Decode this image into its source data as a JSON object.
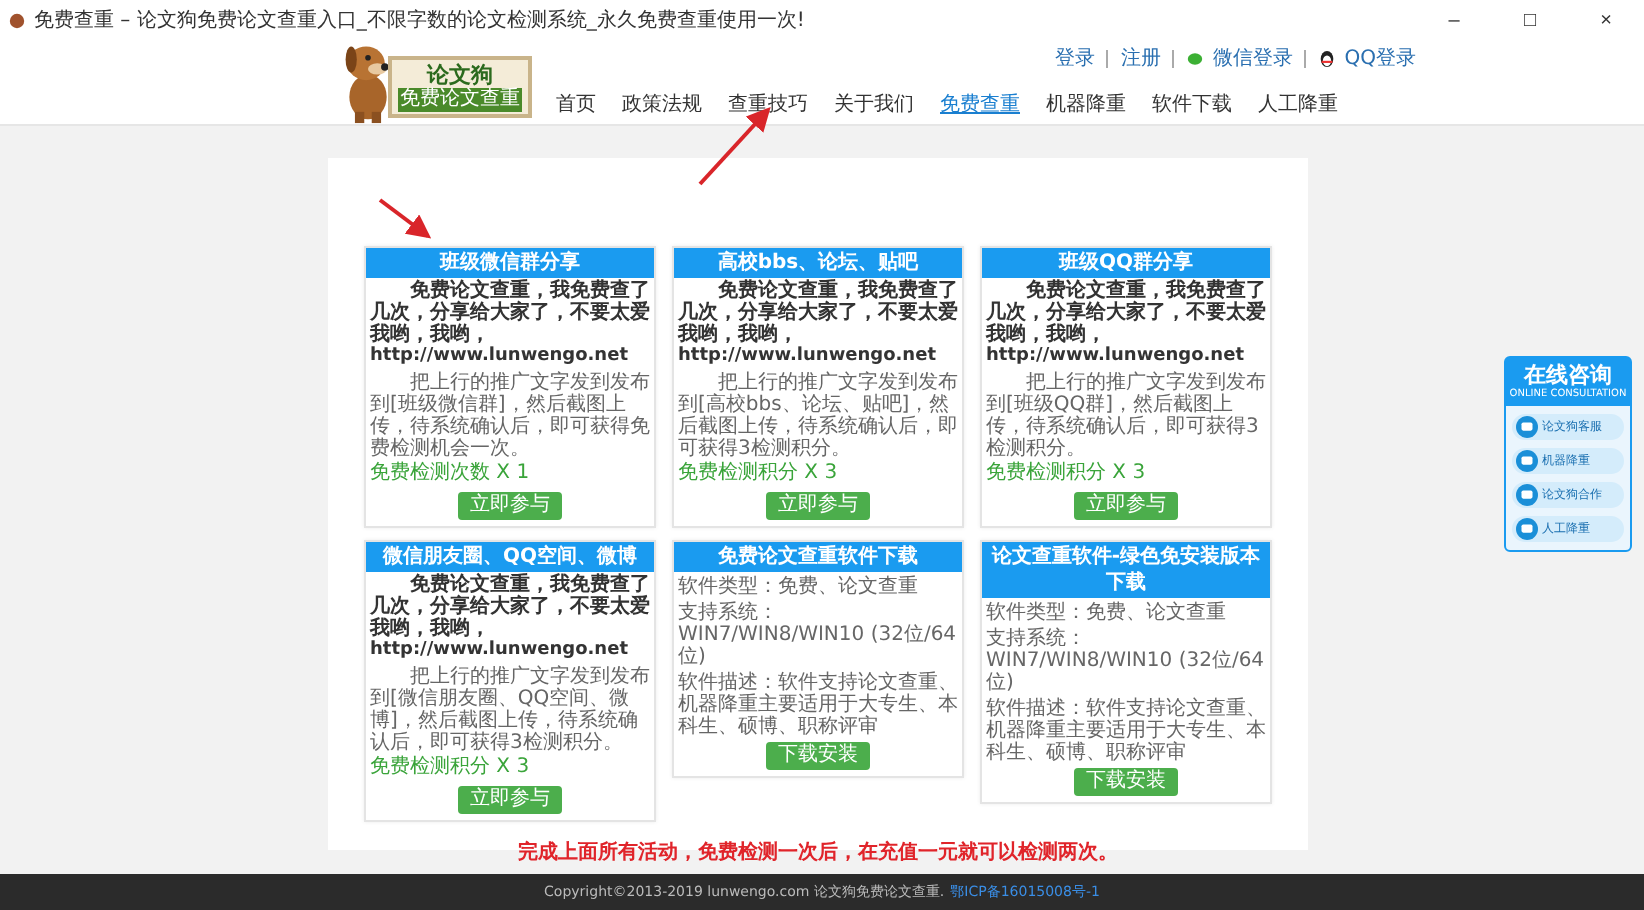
{
  "window": {
    "title": "免费查重 – 论文狗免费论文查重入口_不限字数的论文检测系统_永久免费查重使用一次!",
    "controls": [
      "–",
      "□",
      "×"
    ]
  },
  "logo": {
    "name": "论文狗",
    "tagline": "免费论文查重"
  },
  "top_links": [
    {
      "label": "登录",
      "kind": "text"
    },
    {
      "label": "注册",
      "kind": "text"
    },
    {
      "label": "微信登录",
      "kind": "wechat"
    },
    {
      "label": "QQ登录",
      "kind": "qq"
    }
  ],
  "nav": [
    {
      "label": "首页",
      "selected": false
    },
    {
      "label": "政策法规",
      "selected": false
    },
    {
      "label": "查重技巧",
      "selected": false
    },
    {
      "label": "关于我们",
      "selected": false
    },
    {
      "label": "免费查重",
      "selected": true
    },
    {
      "label": "机器降重",
      "selected": false
    },
    {
      "label": "软件下载",
      "selected": false
    },
    {
      "label": "人工降重",
      "selected": false
    }
  ],
  "cards": [
    {
      "kind": "activity",
      "title": "班级微信群分享",
      "promo": "免费论文查重，我免费查了几次，分享给大家了，不要太爱我哟，我哟，",
      "url": "http://www.lunwengo.net",
      "instruction": "把上行的推广文字发到发布到[班级微信群]，然后截图上传，待系统确认后，即可获得免费检测机会一次。",
      "reward": "免费检测次数 X 1",
      "button": "立即参与"
    },
    {
      "kind": "activity",
      "title": "高校bbs、论坛、贴吧",
      "promo": "免费论文查重，我免费查了几次，分享给大家了，不要太爱我哟，我哟，",
      "url": "http://www.lunwengo.net",
      "instruction": "把上行的推广文字发到发布到[高校bbs、论坛、贴吧]，然后截图上传，待系统确认后，即可获得3检测积分。",
      "reward": "免费检测积分 X 3",
      "button": "立即参与"
    },
    {
      "kind": "activity",
      "title": "班级QQ群分享",
      "promo": "免费论文查重，我免费查了几次，分享给大家了，不要太爱我哟，我哟，",
      "url": "http://www.lunwengo.net",
      "instruction": "把上行的推广文字发到发布到[班级QQ群]，然后截图上传，待系统确认后，即可获得3检测积分。",
      "reward": "免费检测积分 X 3",
      "button": "立即参与"
    },
    {
      "kind": "activity",
      "title": "微信朋友圈、QQ空间、微博",
      "promo": "免费论文查重，我免费查了几次，分享给大家了，不要太爱我哟，我哟，",
      "url": "http://www.lunwengo.net",
      "instruction": "把上行的推广文字发到发布到[微信朋友圈、QQ空间、微博]，然后截图上传，待系统确认后，即可获得3检测积分。",
      "reward": "免费检测积分 X 3",
      "button": "立即参与"
    },
    {
      "kind": "download",
      "title": "免费论文查重软件下载",
      "type": "软件类型：免费、论文查重",
      "system": "支持系统：WIN7/WIN8/WIN10 (32位/64位)",
      "description": "软件描述：软件支持论文查重、机器降重主要适用于大专生、本科生、硕博、职称评审",
      "button": "下载安装"
    },
    {
      "kind": "download",
      "title": "论文查重软件-绿色免安装版本下载",
      "type": "软件类型：免费、论文查重",
      "system": "支持系统：WIN7/WIN8/WIN10 (32位/64位)",
      "description": "软件描述：软件支持论文查重、机器降重主要适用于大专生、本科生、硕博、职称评审",
      "button": "下载安装"
    }
  ],
  "notice": "完成上面所有活动，免费检测一次后，在充值一元就可以检测两次。",
  "consult": {
    "title": "在线咨询",
    "subtitle": "ONLINE CONSULTATION",
    "items": [
      "论文狗客服",
      "机器降重",
      "论文狗合作",
      "人工降重"
    ]
  },
  "footer": {
    "text": "Copyright©2013-2019 lunwengo.com 论文狗免费论文查重.",
    "link": "鄂ICP备16015008号-1"
  }
}
